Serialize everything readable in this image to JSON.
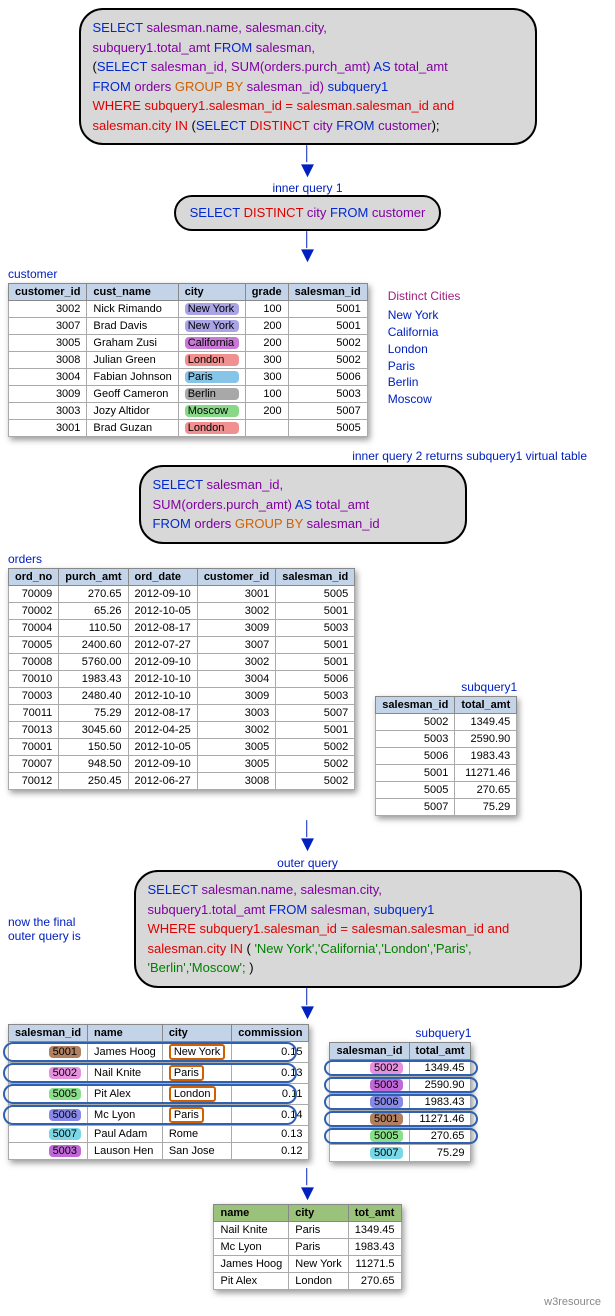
{
  "query_main": {
    "l1a": "SELECT",
    "l1b": " salesman.name, salesman.city,",
    "l2a": "subquery1.total_amt ",
    "l2b": "FROM",
    "l2c": " salesman,",
    "l3a": "(",
    "l3b": "SELECT",
    "l3c": " salesman_id, SUM(orders.purch_amt) ",
    "l3d": "AS",
    "l3e": " total_amt",
    "l4a": "FROM",
    "l4b": " orders ",
    "l4c": "GROUP BY",
    "l4d": " salesman_id) ",
    "l4e": "subquery1",
    "l5a": "WHERE",
    "l5b": " subquery1.salesman_id = salesman.salesman_id ",
    "l5c": "and",
    "l6a": "salesman.city ",
    "l6b": "IN",
    "l6c": " (",
    "l6d": "SELECT ",
    "l6e": "DISTINCT",
    "l6f": " city ",
    "l6g": "FROM",
    "l6h": " customer",
    "l6i": ");"
  },
  "labels": {
    "inner1": "inner query 1",
    "inner2": "inner query 2 returns subquery1 virtual table",
    "outer": "outer query",
    "final_outer": "now the final outer query is",
    "customer": "customer",
    "orders": "orders",
    "subquery1": "subquery1",
    "distinct_hdr": "Distinct Cities",
    "footer": "w3resource"
  },
  "distinct_query": {
    "a": "SELECT ",
    "b": "DISTINCT",
    "c": " city ",
    "d": "FROM",
    "e": " customer"
  },
  "distinct_list": [
    "New York",
    "California",
    "London",
    "Paris",
    "Berlin",
    "Moscow"
  ],
  "customer": {
    "cols": [
      "customer_id",
      "cust_name",
      "city",
      "grade",
      "salesman_id"
    ],
    "rows": [
      {
        "id": "3002",
        "name": "Nick Rimando",
        "city": "New York",
        "cc": "c-ny",
        "grade": "100",
        "sid": "5001"
      },
      {
        "id": "3007",
        "name": "Brad Davis",
        "city": "New York",
        "cc": "c-ny",
        "grade": "200",
        "sid": "5001"
      },
      {
        "id": "3005",
        "name": "Graham Zusi",
        "city": "California",
        "cc": "c-ca",
        "grade": "200",
        "sid": "5002"
      },
      {
        "id": "3008",
        "name": "Julian Green",
        "city": "London",
        "cc": "c-lo",
        "grade": "300",
        "sid": "5002"
      },
      {
        "id": "3004",
        "name": "Fabian Johnson",
        "city": "Paris",
        "cc": "c-pa",
        "grade": "300",
        "sid": "5006"
      },
      {
        "id": "3009",
        "name": "Geoff Cameron",
        "city": "Berlin",
        "cc": "c-be",
        "grade": "100",
        "sid": "5003"
      },
      {
        "id": "3003",
        "name": "Jozy Altidor",
        "city": "Moscow",
        "cc": "c-mo",
        "grade": "200",
        "sid": "5007"
      },
      {
        "id": "3001",
        "name": "Brad Guzan",
        "city": "London",
        "cc": "c-lo",
        "grade": "",
        "sid": "5005"
      }
    ]
  },
  "inner2_query": {
    "l1a": "SELECT",
    "l1b": " salesman_id,",
    "l2a": "SUM(orders.purch_amt) ",
    "l2b": "AS",
    "l2c": " total_amt",
    "l3a": "FROM",
    "l3b": " orders ",
    "l3c": "GROUP BY",
    "l3d": " salesman_id"
  },
  "orders": {
    "cols": [
      "ord_no",
      "purch_amt",
      "ord_date",
      "customer_id",
      "salesman_id"
    ],
    "rows": [
      [
        "70009",
        "270.65",
        "2012-09-10",
        "3001",
        "5005"
      ],
      [
        "70002",
        "65.26",
        "2012-10-05",
        "3002",
        "5001"
      ],
      [
        "70004",
        "110.50",
        "2012-08-17",
        "3009",
        "5003"
      ],
      [
        "70005",
        "2400.60",
        "2012-07-27",
        "3007",
        "5001"
      ],
      [
        "70008",
        "5760.00",
        "2012-09-10",
        "3002",
        "5001"
      ],
      [
        "70010",
        "1983.43",
        "2012-10-10",
        "3004",
        "5006"
      ],
      [
        "70003",
        "2480.40",
        "2012-10-10",
        "3009",
        "5003"
      ],
      [
        "70011",
        "75.29",
        "2012-08-17",
        "3003",
        "5007"
      ],
      [
        "70013",
        "3045.60",
        "2012-04-25",
        "3002",
        "5001"
      ],
      [
        "70001",
        "150.50",
        "2012-10-05",
        "3005",
        "5002"
      ],
      [
        "70007",
        "948.50",
        "2012-09-10",
        "3005",
        "5002"
      ],
      [
        "70012",
        "250.45",
        "2012-06-27",
        "3008",
        "5002"
      ]
    ]
  },
  "subquery1": {
    "cols": [
      "salesman_id",
      "total_amt"
    ],
    "rows": [
      [
        "5002",
        "1349.45"
      ],
      [
        "5003",
        "2590.90"
      ],
      [
        "5006",
        "1983.43"
      ],
      [
        "5001",
        "11271.46"
      ],
      [
        "5005",
        "270.65"
      ],
      [
        "5007",
        "75.29"
      ]
    ]
  },
  "outer_query": {
    "l1a": "SELECT",
    "l1b": " salesman.name, salesman.city,",
    "l2a": "subquery1.total_amt ",
    "l2b": "FROM",
    "l2c": " salesman,  ",
    "l2d": "subquery1",
    "l3a": "WHERE",
    "l3b": " subquery1.salesman_id = salesman.salesman_id ",
    "l3c": "and",
    "l4a": "salesman.city ",
    "l4b": "IN",
    "l4c": " (  ",
    "l4d": "'New York','California','London','Paris',",
    "l5a": "'Berlin','Moscow'; ",
    "l5b": ")"
  },
  "salesman": {
    "cols": [
      "salesman_id",
      "name",
      "city",
      "commission"
    ],
    "rows": [
      {
        "sid": "5001",
        "pc": "p-5001",
        "name": "James Hoog",
        "city": "New York",
        "boxed": true,
        "com": "0.15",
        "ring": true
      },
      {
        "sid": "5002",
        "pc": "p-5002",
        "name": "Nail Knite",
        "city": "Paris",
        "boxed": true,
        "com": "0.13",
        "ring": true
      },
      {
        "sid": "5005",
        "pc": "p-5005",
        "name": "Pit Alex",
        "city": "London",
        "boxed": true,
        "com": "0.11",
        "ring": true
      },
      {
        "sid": "5006",
        "pc": "p-5006",
        "name": "Mc Lyon",
        "city": "Paris",
        "boxed": true,
        "com": "0.14",
        "ring": true
      },
      {
        "sid": "5007",
        "pc": "p-5007",
        "name": "Paul Adam",
        "city": "Rome",
        "boxed": false,
        "com": "0.13",
        "ring": false
      },
      {
        "sid": "5003",
        "pc": "p-5003",
        "name": "Lauson Hen",
        "city": "San Jose",
        "boxed": false,
        "com": "0.12",
        "ring": false
      }
    ]
  },
  "subquery1b": {
    "cols": [
      "salesman_id",
      "total_amt"
    ],
    "rows": [
      {
        "sid": "5002",
        "pc": "p-5002",
        "amt": "1349.45",
        "ring": true
      },
      {
        "sid": "5003",
        "pc": "p-5003",
        "amt": "2590.90",
        "ring": true
      },
      {
        "sid": "5006",
        "pc": "p-5006",
        "amt": "1983.43",
        "ring": true
      },
      {
        "sid": "5001",
        "pc": "p-5001",
        "amt": "11271.46",
        "ring": true
      },
      {
        "sid": "5005",
        "pc": "p-5005",
        "amt": "270.65",
        "ring": true
      },
      {
        "sid": "5007",
        "pc": "p-5007",
        "amt": "75.29",
        "ring": false
      }
    ]
  },
  "result": {
    "cols": [
      "name",
      "city",
      "tot_amt"
    ],
    "rows": [
      [
        "Nail Knite",
        "Paris",
        "1349.45"
      ],
      [
        "Mc Lyon",
        "Paris",
        "1983.43"
      ],
      [
        "James Hoog",
        "New York",
        "11271.5"
      ],
      [
        "Pit Alex",
        "London",
        "270.65"
      ]
    ]
  }
}
